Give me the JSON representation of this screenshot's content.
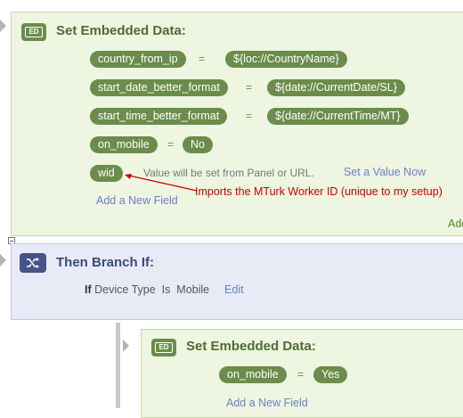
{
  "embedded_block": {
    "icon": "ED",
    "title": "Set Embedded Data:",
    "rows": [
      {
        "name": "country_from_ip",
        "eq": "=",
        "value": "${loc://CountryName}"
      },
      {
        "name": "start_date_better_format",
        "eq": "=",
        "value": "${date://CurrentDate/SL}"
      },
      {
        "name": "start_time_better_format",
        "eq": "=",
        "value": "${date://CurrentTime/MT}"
      },
      {
        "name": "on_mobile",
        "eq": "=",
        "value": "No"
      }
    ],
    "wid_field": {
      "name": "wid",
      "hint": "Value will be set from Panel or URL.",
      "set_link": "Set a Value Now"
    },
    "annotation": "Imports the MTurk Worker ID (unique to my setup)",
    "add_field": "Add a New Field",
    "add_right": "Add"
  },
  "branch_block": {
    "icon": "shuffle-icon",
    "title": "Then Branch If:",
    "condition": {
      "if_label": "If",
      "text": "Device Type  Is  Mobile",
      "edit": "Edit"
    }
  },
  "nested_block": {
    "icon": "ED",
    "title": "Set Embedded Data:",
    "row": {
      "name": "on_mobile",
      "eq": "=",
      "value": "Yes"
    },
    "add_field": "Add a New Field"
  },
  "colors": {
    "green_bg": "#eef5e1",
    "green_pill": "#6b8c4b",
    "blue_bg": "#e8ebf6",
    "blue_icon": "#475388",
    "link": "#6b7fc4",
    "annotation": "#cc0000"
  }
}
